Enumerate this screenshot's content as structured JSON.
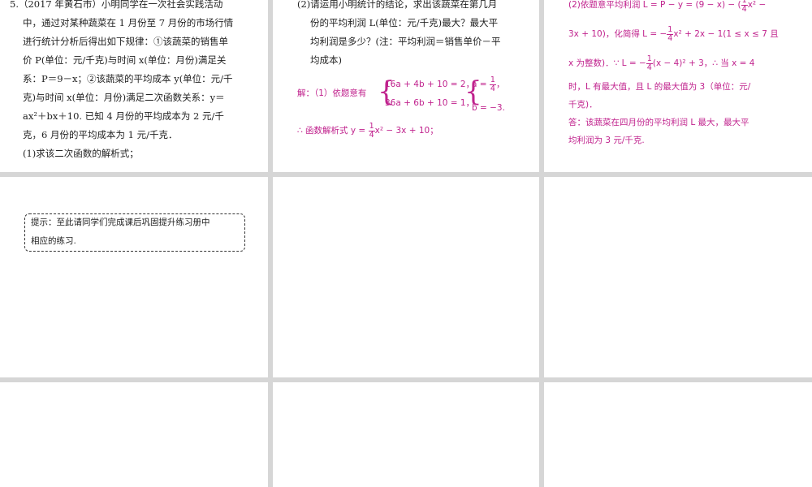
{
  "colors": {
    "answer": "#c0228d",
    "panel": "#ffffff",
    "gutter": "#d6d6d6"
  },
  "problem": {
    "lines": [
      "5.（2017 年黄石市）小明同学在一次社会实践活动",
      "中，通过对某种蔬菜在 1 月份至 7 月份的市场行情",
      "进行统计分析后得出如下规律：①该蔬菜的销售单",
      "价 P(单位：元/千克)与时间 x(单位：月份)满足关",
      "系：P＝9－x；②该蔬菜的平均成本 y(单位：元/千",
      "克)与时间 x(单位：月份)满足二次函数关系：y＝",
      "ax²＋bx＋10. 已知 4 月份的平均成本为 2 元/千",
      "克，6 月份的平均成本为 1 元/千克．",
      "(1)求该二次函数的解析式；"
    ]
  },
  "question2": {
    "lines": [
      "(2)请运用小明统计的结论，求出该蔬菜在第几月",
      "份的平均利润 L(单位：元/千克)最大？最大平",
      "均利润是多少？(注：平均利润＝销售单价－平",
      "均成本)"
    ]
  },
  "solution1": {
    "prefix": "解：（1）依题意有",
    "eq1": "16a + 4b + 10 = 2，",
    "eq2": "36a + 6b + 10 = 1，",
    "a_label": "a =",
    "a_num": "1",
    "a_den": "4",
    "a_end": "，",
    "b_sol": "b = −3.",
    "result_prefix": "∴ 函数解析式 y =",
    "result_num": "1",
    "result_den": "4",
    "result_suffix": "x² − 3x + 10；"
  },
  "solution2": {
    "l1_a": "(2)依题意平均利润 L = P − y = (9 − x) − (",
    "l1_num": "1",
    "l1_den": "4",
    "l1_b": "x² −",
    "l2_a": "3x + 10)，化简得 L = −",
    "l2_num": "1",
    "l2_den": "4",
    "l2_b": "x² + 2x − 1(1 ≤ x ≤ 7 且",
    "l3_a": "x 为整数)．∵ L = −",
    "l3_num": "1",
    "l3_den": "4",
    "l3_b": "(x − 4)² + 3，∴ 当 x = 4",
    "l4": "时，L 有最大值，且 L 的最大值为 3（单位：元/",
    "l5": "千克)．",
    "l6": "答：该蔬菜在四月份的平均利润 L 最大，最大平",
    "l7": "均利润为 3 元/千克."
  },
  "hint": {
    "line1": "提示：至此请同学们完成课后巩固提升练习册中",
    "line2": "相应的练习."
  }
}
